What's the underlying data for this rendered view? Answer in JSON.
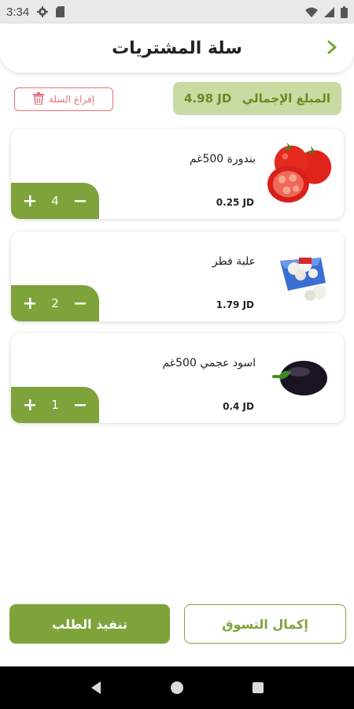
{
  "status_bar": {
    "time": "3:34"
  },
  "header": {
    "title": "سلة المشتريات"
  },
  "summary": {
    "total_label": "المبلغ الإجمالي",
    "total_value": "4.98 JD",
    "empty_cart_label": "إفراغ السلة"
  },
  "cart": {
    "items": [
      {
        "name": "بندورة 500غم",
        "price": "0.25 JD",
        "quantity": "4",
        "icon": "tomato-image"
      },
      {
        "name": "علبة فطر",
        "price": "1.79 JD",
        "quantity": "2",
        "icon": "mushroom-box-image"
      },
      {
        "name": "اسود عجمي 500غم",
        "price": "0.4 JD",
        "quantity": "1",
        "icon": "eggplant-image"
      }
    ]
  },
  "actions": {
    "checkout_label": "تنفيذ الطلب",
    "continue_label": "إكمال التسوق"
  },
  "colors": {
    "accent": "#7fa33b",
    "accent_light": "#c8dba2",
    "danger": "#e4717a"
  }
}
